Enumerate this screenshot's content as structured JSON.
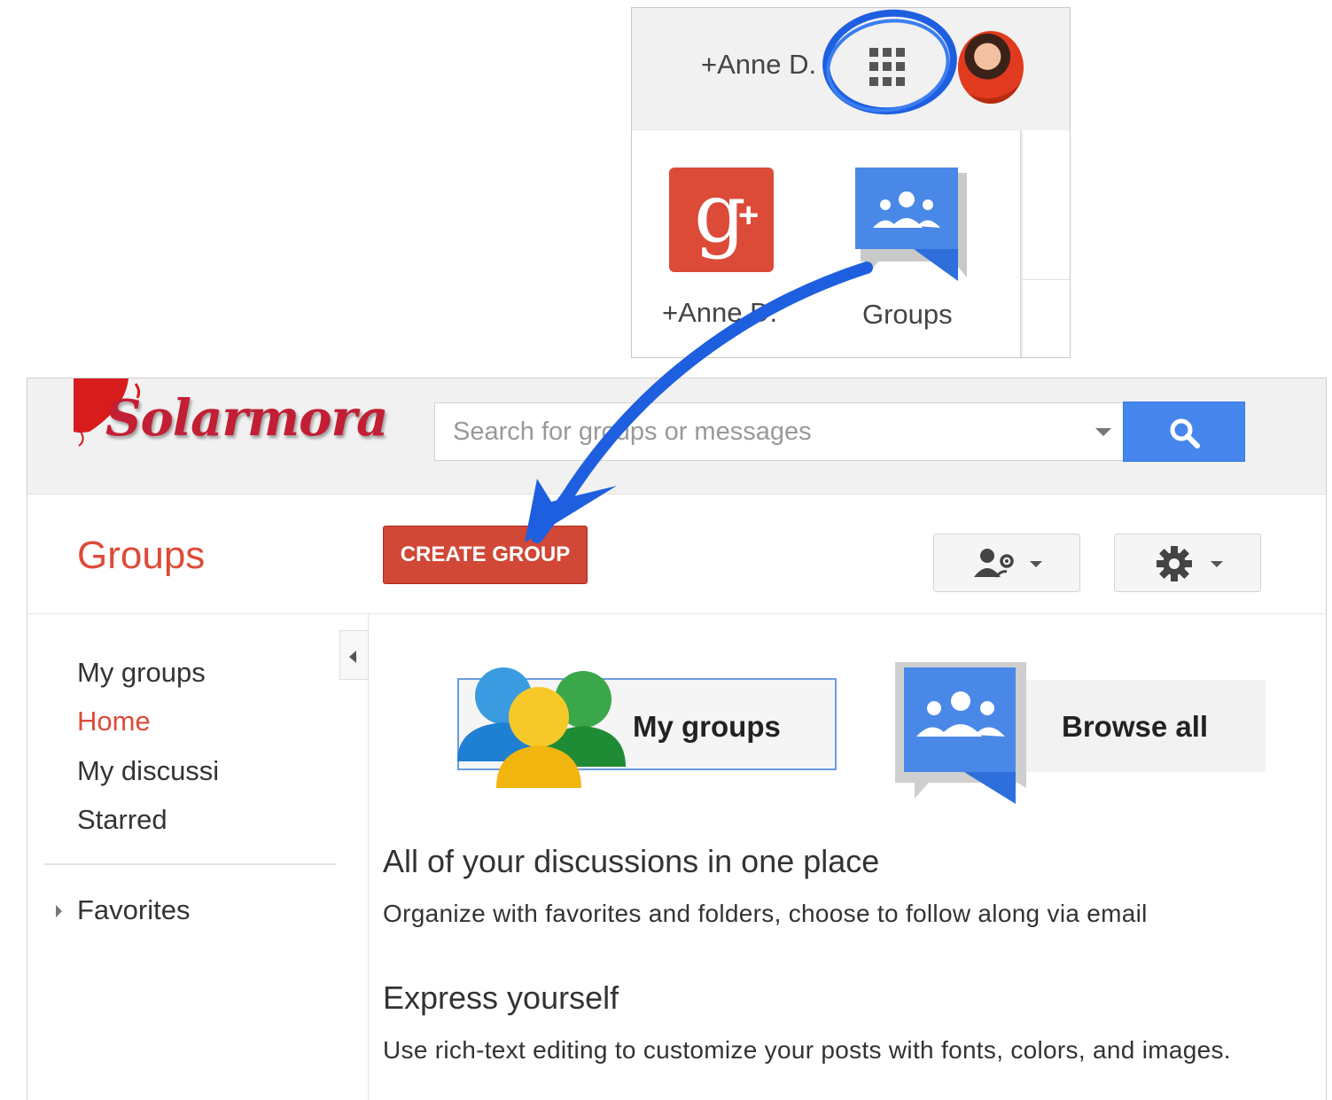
{
  "inset": {
    "user_name": "+Anne D.",
    "apps_icon": "apps-grid-icon",
    "avatar_icon": "user-avatar",
    "apps": [
      {
        "label": "+Anne D.",
        "icon": "google-plus-icon",
        "color": "#dc4a38"
      },
      {
        "label": "Groups",
        "icon": "google-groups-icon",
        "color": "#4285f4"
      }
    ]
  },
  "header": {
    "logo_text": "Solarmora",
    "search_placeholder": "Search for groups or messages",
    "search_icon": "search-icon"
  },
  "toolbar": {
    "title": "Groups",
    "create_label": "CREATE GROUP",
    "members_icon": "members-settings-icon",
    "settings_icon": "gear-icon"
  },
  "sidebar": {
    "items": [
      {
        "label": "My groups",
        "selected": false
      },
      {
        "label": "Home",
        "selected": true
      },
      {
        "label": "My discussi",
        "selected": false
      },
      {
        "label": "Starred",
        "selected": false
      }
    ],
    "favorites": "Favorites"
  },
  "content": {
    "my_groups_label": "My groups",
    "browse_all_label": "Browse all",
    "heading_1": "All of your discussions in one place",
    "text_1": "Organize with favorites and folders, choose to follow along via email",
    "heading_2": "Express yourself",
    "text_2": "Use rich-text editing to customize your posts with fonts, colors, and images."
  },
  "colors": {
    "accent_red": "#dd4b39",
    "create_button": "#d14836",
    "search_blue": "#4787ed",
    "annotation_blue": "#1e5fe0"
  }
}
